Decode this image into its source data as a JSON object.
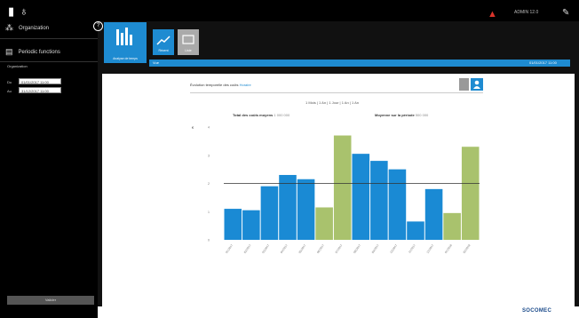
{
  "topbar": {
    "user_text": "ADMIN 12.0"
  },
  "sidebar": {
    "items": [
      {
        "label": "Organization"
      },
      {
        "label": "Periodic functions"
      }
    ],
    "section_label": "Organization",
    "date_from_label": "Du",
    "date_from_value": "01/01/2017 11:00",
    "date_to_label": "Au",
    "date_to_value": "31/12/2017 11:00",
    "apply_label": "Valider"
  },
  "tiles": {
    "analysis_label": "Analyse de temps",
    "recent_label": "Récent",
    "gray_label": "Liste"
  },
  "bluebar": {
    "left_text": "Vue",
    "right_text": "01/01/2017 11:00"
  },
  "panel": {
    "title": "Évolution temporelle des coûts",
    "title_link": "Horaire",
    "time_options": "1 Mois | 1 An | 1 Jour | 1 An | 1 An",
    "stat_left_label": "Total des coûts moyens",
    "stat_left_value": "1 000 000",
    "stat_right_label": "Moyenne sur la période",
    "stat_right_value": "500 000"
  },
  "footer": {
    "logo_text": "SOCOMEC"
  },
  "chart_data": {
    "type": "bar",
    "categories": [
      "01/2017",
      "02/2017",
      "03/2017",
      "04/2017",
      "05/2017",
      "06/2017",
      "07/2017",
      "08/2017",
      "09/2017",
      "10/2017",
      "11/2017",
      "12/2017",
      "01/2018",
      "02/2018"
    ],
    "values": [
      1.1,
      1.05,
      1.9,
      2.3,
      2.15,
      1.15,
      3.7,
      3.05,
      2.8,
      2.5,
      0.65,
      1.8,
      0.95,
      3.3
    ],
    "highlight": [
      false,
      false,
      false,
      false,
      false,
      true,
      true,
      false,
      false,
      false,
      false,
      false,
      true,
      true
    ],
    "reference_line": 2.0,
    "ylim": [
      0,
      4
    ],
    "yticks": [
      "0",
      "1",
      "2",
      "3",
      "4"
    ],
    "ylabel": "€",
    "colors": {
      "normal": "#1a8ad4",
      "highlight": "#a9c26d",
      "reference": "#333333"
    }
  }
}
